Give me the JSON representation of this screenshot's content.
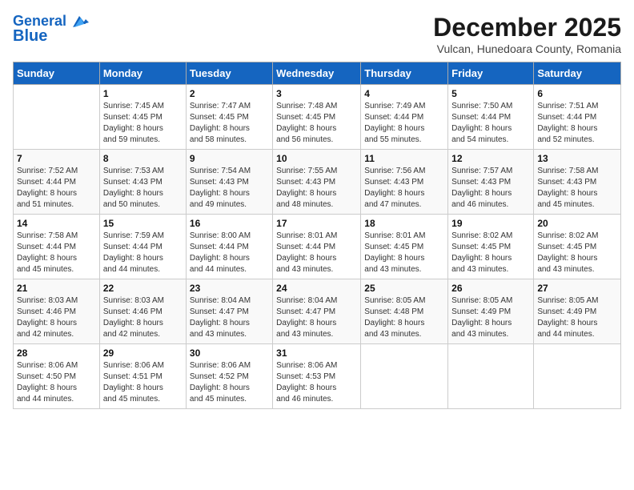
{
  "header": {
    "logo_line1": "General",
    "logo_line2": "Blue",
    "month_title": "December 2025",
    "subtitle": "Vulcan, Hunedoara County, Romania"
  },
  "days_of_week": [
    "Sunday",
    "Monday",
    "Tuesday",
    "Wednesday",
    "Thursday",
    "Friday",
    "Saturday"
  ],
  "weeks": [
    [
      {
        "day": "",
        "info": ""
      },
      {
        "day": "1",
        "info": "Sunrise: 7:45 AM\nSunset: 4:45 PM\nDaylight: 8 hours\nand 59 minutes."
      },
      {
        "day": "2",
        "info": "Sunrise: 7:47 AM\nSunset: 4:45 PM\nDaylight: 8 hours\nand 58 minutes."
      },
      {
        "day": "3",
        "info": "Sunrise: 7:48 AM\nSunset: 4:45 PM\nDaylight: 8 hours\nand 56 minutes."
      },
      {
        "day": "4",
        "info": "Sunrise: 7:49 AM\nSunset: 4:44 PM\nDaylight: 8 hours\nand 55 minutes."
      },
      {
        "day": "5",
        "info": "Sunrise: 7:50 AM\nSunset: 4:44 PM\nDaylight: 8 hours\nand 54 minutes."
      },
      {
        "day": "6",
        "info": "Sunrise: 7:51 AM\nSunset: 4:44 PM\nDaylight: 8 hours\nand 52 minutes."
      }
    ],
    [
      {
        "day": "7",
        "info": "Sunrise: 7:52 AM\nSunset: 4:44 PM\nDaylight: 8 hours\nand 51 minutes."
      },
      {
        "day": "8",
        "info": "Sunrise: 7:53 AM\nSunset: 4:43 PM\nDaylight: 8 hours\nand 50 minutes."
      },
      {
        "day": "9",
        "info": "Sunrise: 7:54 AM\nSunset: 4:43 PM\nDaylight: 8 hours\nand 49 minutes."
      },
      {
        "day": "10",
        "info": "Sunrise: 7:55 AM\nSunset: 4:43 PM\nDaylight: 8 hours\nand 48 minutes."
      },
      {
        "day": "11",
        "info": "Sunrise: 7:56 AM\nSunset: 4:43 PM\nDaylight: 8 hours\nand 47 minutes."
      },
      {
        "day": "12",
        "info": "Sunrise: 7:57 AM\nSunset: 4:43 PM\nDaylight: 8 hours\nand 46 minutes."
      },
      {
        "day": "13",
        "info": "Sunrise: 7:58 AM\nSunset: 4:43 PM\nDaylight: 8 hours\nand 45 minutes."
      }
    ],
    [
      {
        "day": "14",
        "info": "Sunrise: 7:58 AM\nSunset: 4:44 PM\nDaylight: 8 hours\nand 45 minutes."
      },
      {
        "day": "15",
        "info": "Sunrise: 7:59 AM\nSunset: 4:44 PM\nDaylight: 8 hours\nand 44 minutes."
      },
      {
        "day": "16",
        "info": "Sunrise: 8:00 AM\nSunset: 4:44 PM\nDaylight: 8 hours\nand 44 minutes."
      },
      {
        "day": "17",
        "info": "Sunrise: 8:01 AM\nSunset: 4:44 PM\nDaylight: 8 hours\nand 43 minutes."
      },
      {
        "day": "18",
        "info": "Sunrise: 8:01 AM\nSunset: 4:45 PM\nDaylight: 8 hours\nand 43 minutes."
      },
      {
        "day": "19",
        "info": "Sunrise: 8:02 AM\nSunset: 4:45 PM\nDaylight: 8 hours\nand 43 minutes."
      },
      {
        "day": "20",
        "info": "Sunrise: 8:02 AM\nSunset: 4:45 PM\nDaylight: 8 hours\nand 43 minutes."
      }
    ],
    [
      {
        "day": "21",
        "info": "Sunrise: 8:03 AM\nSunset: 4:46 PM\nDaylight: 8 hours\nand 42 minutes."
      },
      {
        "day": "22",
        "info": "Sunrise: 8:03 AM\nSunset: 4:46 PM\nDaylight: 8 hours\nand 42 minutes."
      },
      {
        "day": "23",
        "info": "Sunrise: 8:04 AM\nSunset: 4:47 PM\nDaylight: 8 hours\nand 43 minutes."
      },
      {
        "day": "24",
        "info": "Sunrise: 8:04 AM\nSunset: 4:47 PM\nDaylight: 8 hours\nand 43 minutes."
      },
      {
        "day": "25",
        "info": "Sunrise: 8:05 AM\nSunset: 4:48 PM\nDaylight: 8 hours\nand 43 minutes."
      },
      {
        "day": "26",
        "info": "Sunrise: 8:05 AM\nSunset: 4:49 PM\nDaylight: 8 hours\nand 43 minutes."
      },
      {
        "day": "27",
        "info": "Sunrise: 8:05 AM\nSunset: 4:49 PM\nDaylight: 8 hours\nand 44 minutes."
      }
    ],
    [
      {
        "day": "28",
        "info": "Sunrise: 8:06 AM\nSunset: 4:50 PM\nDaylight: 8 hours\nand 44 minutes."
      },
      {
        "day": "29",
        "info": "Sunrise: 8:06 AM\nSunset: 4:51 PM\nDaylight: 8 hours\nand 45 minutes."
      },
      {
        "day": "30",
        "info": "Sunrise: 8:06 AM\nSunset: 4:52 PM\nDaylight: 8 hours\nand 45 minutes."
      },
      {
        "day": "31",
        "info": "Sunrise: 8:06 AM\nSunset: 4:53 PM\nDaylight: 8 hours\nand 46 minutes."
      },
      {
        "day": "",
        "info": ""
      },
      {
        "day": "",
        "info": ""
      },
      {
        "day": "",
        "info": ""
      }
    ]
  ]
}
